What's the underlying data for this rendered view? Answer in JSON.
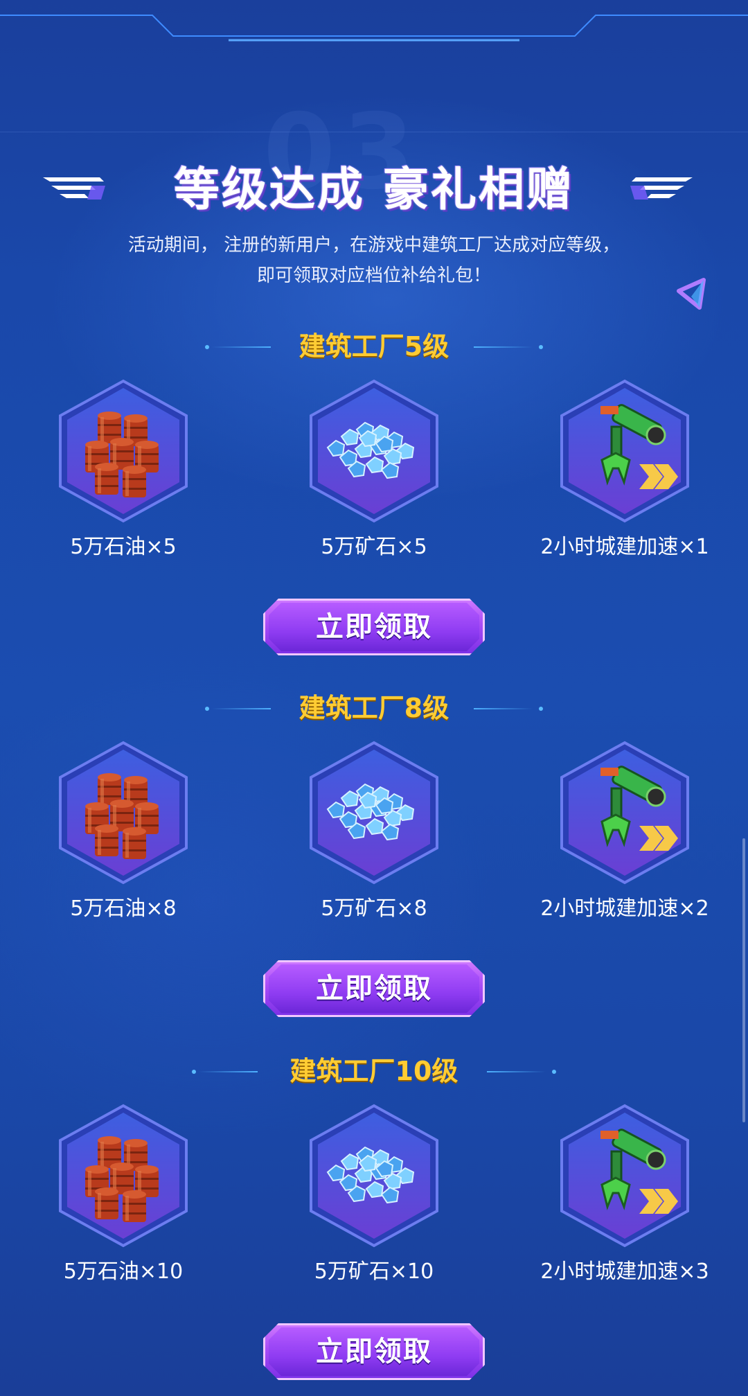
{
  "header": {
    "title": "等级达成 豪礼相赠",
    "description_line1": "活动期间， 注册的新用户，在游戏中建筑工厂达成对应等级，",
    "description_line2": "即可领取对应档位补给礼包！"
  },
  "tiers": [
    {
      "title": "建筑工厂5级",
      "rewards": [
        {
          "label": "5万石油×5",
          "icon": "oil-barrels-icon"
        },
        {
          "label": "5万矿石×5",
          "icon": "ore-crystals-icon"
        },
        {
          "label": "2小时城建加速×1",
          "icon": "build-speedup-claw-icon"
        }
      ],
      "button_label": "立即领取"
    },
    {
      "title": "建筑工厂8级",
      "rewards": [
        {
          "label": "5万石油×8",
          "icon": "oil-barrels-icon"
        },
        {
          "label": "5万矿石×8",
          "icon": "ore-crystals-icon"
        },
        {
          "label": "2小时城建加速×2",
          "icon": "build-speedup-claw-icon"
        }
      ],
      "button_label": "立即领取"
    },
    {
      "title": "建筑工厂10级",
      "rewards": [
        {
          "label": "5万石油×10",
          "icon": "oil-barrels-icon"
        },
        {
          "label": "5万矿石×10",
          "icon": "ore-crystals-icon"
        },
        {
          "label": "2小时城建加速×3",
          "icon": "build-speedup-claw-icon"
        }
      ],
      "button_label": "立即领取"
    }
  ],
  "colors": {
    "background": "#1b4db0",
    "tier_title": "#ffcc33",
    "button": "#a84cf6",
    "hex_fill": "#5a3fd0"
  }
}
